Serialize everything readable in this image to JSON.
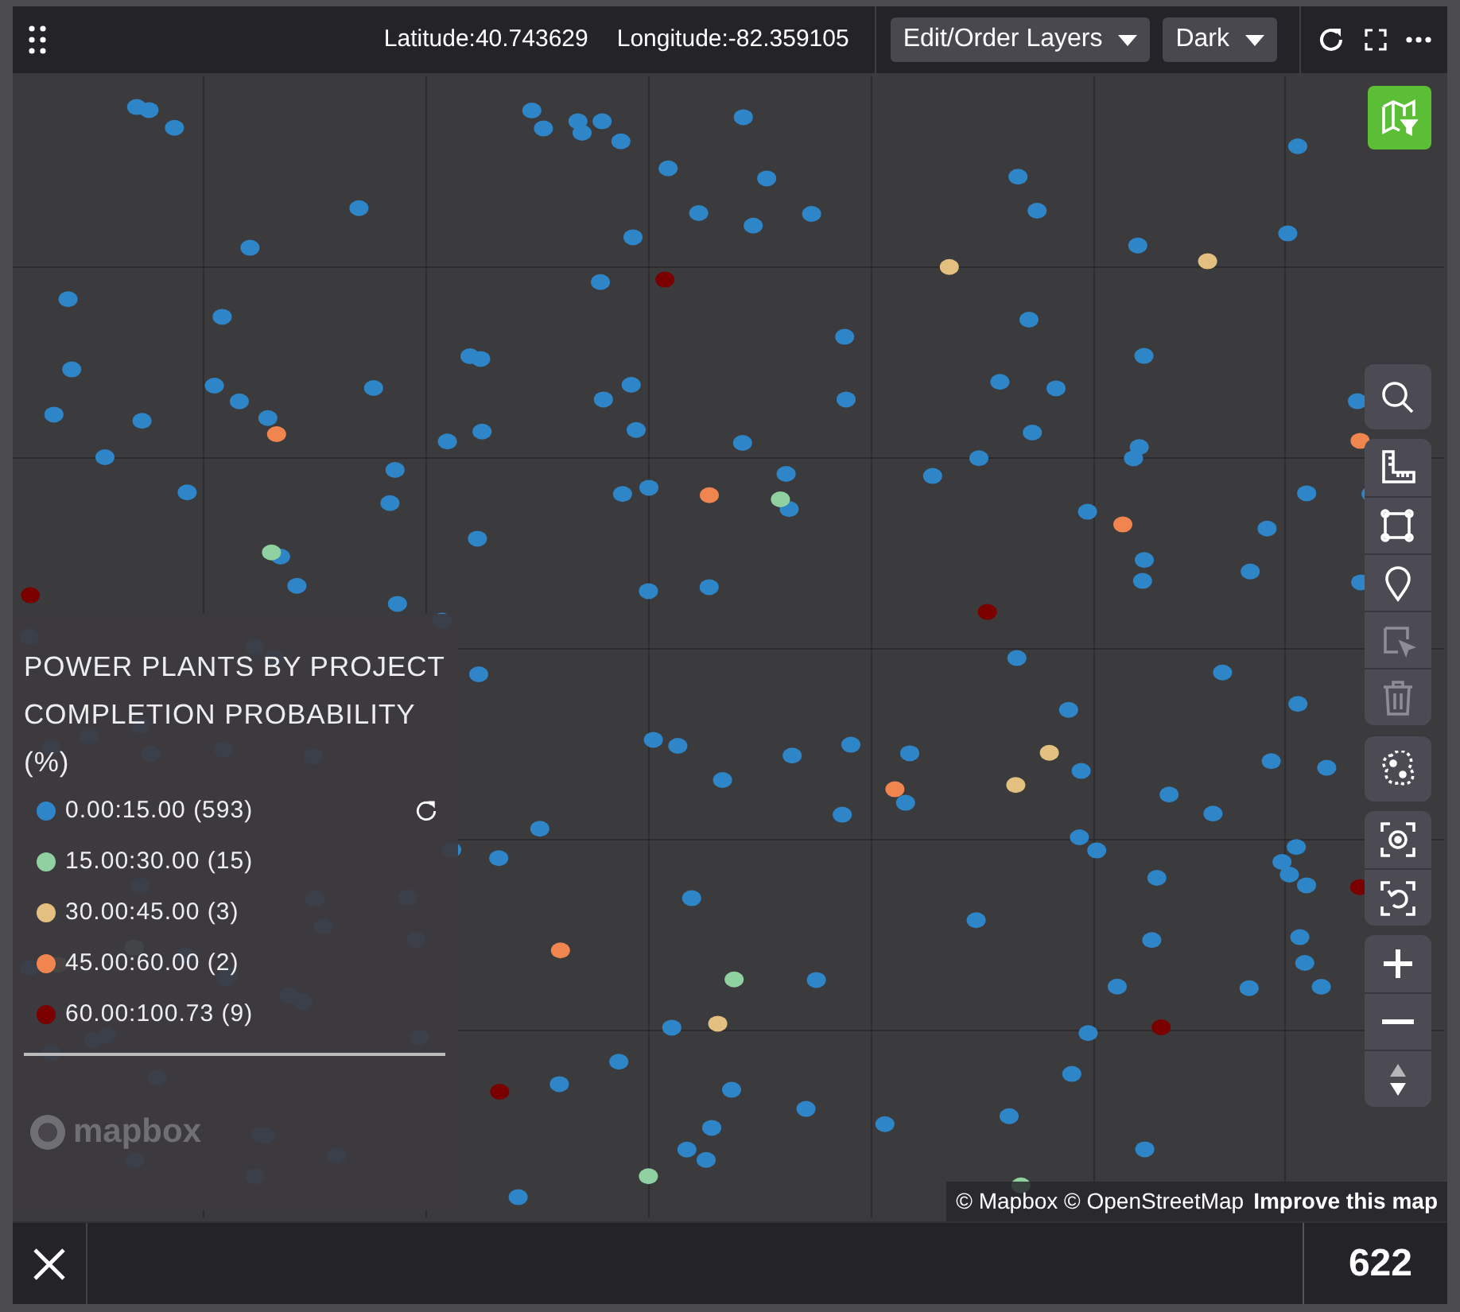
{
  "top_bar": {
    "latitude": "Latitude:40.743629",
    "longitude": "Longitude:-82.359105",
    "dropdowns": [
      {
        "label": "Edit/Order Layers"
      },
      {
        "label": "Dark"
      }
    ]
  },
  "legend": {
    "title": "POWER PLANTS BY PROJECT COMPLETION PROBABILITY (%)",
    "items": [
      {
        "label": "0.00:15.00 (593)",
        "color": "#2e86c8"
      },
      {
        "label": "15.00:30.00 (15)",
        "color": "#8fd1a0"
      },
      {
        "label": "30.00:45.00 (3)",
        "color": "#e3bf80"
      },
      {
        "label": "45.00:60.00 (2)",
        "color": "#f08550"
      },
      {
        "label": "60.00:100.73 (9)",
        "color": "#7a0000"
      }
    ]
  },
  "map_logo": "mapbox",
  "attribution": {
    "text": "© Mapbox © OpenStreetMap",
    "link": "Improve this map"
  },
  "tool_groups": [
    [
      {
        "kind": "search",
        "disabled": false
      }
    ],
    [
      {
        "kind": "measure",
        "disabled": false
      },
      {
        "kind": "polygon",
        "disabled": false
      },
      {
        "kind": "pin",
        "disabled": false
      },
      {
        "kind": "select",
        "disabled": true
      },
      {
        "kind": "trash",
        "disabled": true
      }
    ],
    [
      {
        "kind": "cluster",
        "disabled": false
      }
    ],
    [
      {
        "kind": "locate",
        "disabled": false
      },
      {
        "kind": "reset",
        "disabled": false
      }
    ],
    [
      {
        "kind": "zoom_in",
        "disabled": false
      },
      {
        "kind": "zoom_out",
        "disabled": false
      },
      {
        "kind": "compass",
        "disabled": false
      }
    ]
  ],
  "bottom_bar": {
    "count": "622"
  }
}
